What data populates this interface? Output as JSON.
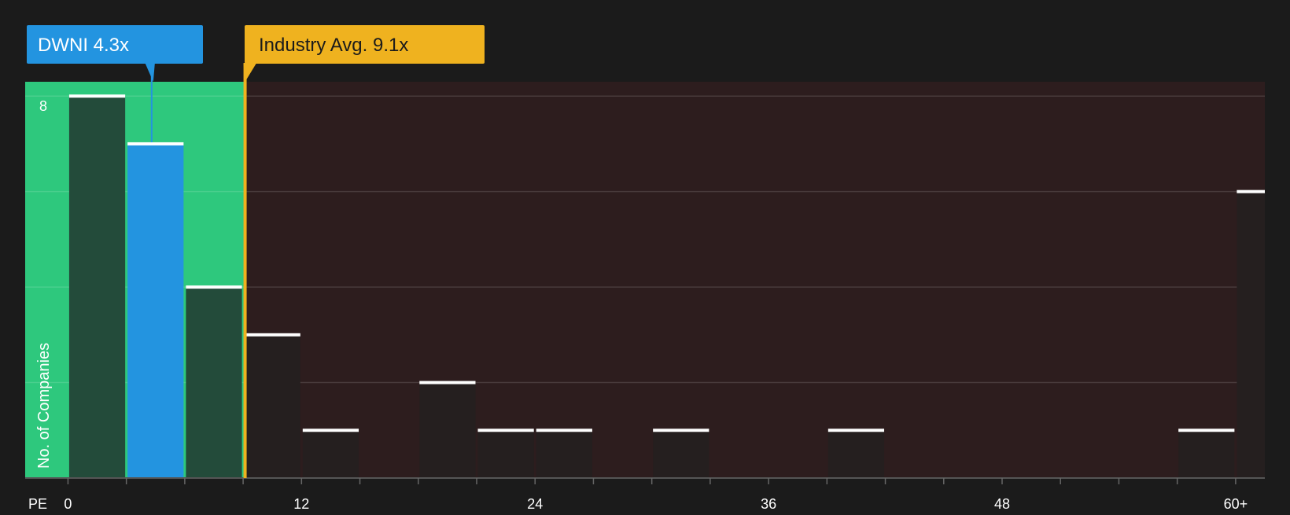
{
  "colors": {
    "background": "#1b1b1b",
    "plot_background": "#2d1d1e",
    "undervalued_zone": "#2ec87d",
    "bar_in_zone": "#234b3a",
    "bar_out_zone": "#251f1f",
    "highlight_bar": "#2394e0",
    "bar_cap": "#ffffff",
    "industry_line": "#efb21f",
    "gridline": "#4a3a3b",
    "axis_text": "#ffffff"
  },
  "callouts": {
    "company": {
      "label": "DWNI 4.3x",
      "value": 4.3
    },
    "industry": {
      "label": "Industry Avg. 9.1x",
      "value": 9.1
    }
  },
  "chart_data": {
    "type": "bar",
    "title": "",
    "xlabel": "PE",
    "ylabel": "No. of Companies",
    "x_ticks": [
      "0",
      "12",
      "24",
      "36",
      "48",
      "60+"
    ],
    "x_tick_values": [
      0,
      12,
      24,
      36,
      48,
      60
    ],
    "y_tick_labels": [
      "8"
    ],
    "ylim": [
      0,
      8.3
    ],
    "xlim": [
      -2.2,
      61.5
    ],
    "bin_width": 3,
    "undervalued_max_pe": 9.1,
    "bins": [
      {
        "start": 0,
        "end": 3,
        "count": 8
      },
      {
        "start": 3,
        "end": 6,
        "count": 7,
        "highlight": true
      },
      {
        "start": 6,
        "end": 9,
        "count": 4
      },
      {
        "start": 9,
        "end": 12,
        "count": 3
      },
      {
        "start": 12,
        "end": 15,
        "count": 1
      },
      {
        "start": 18,
        "end": 21,
        "count": 2
      },
      {
        "start": 21,
        "end": 24,
        "count": 1
      },
      {
        "start": 24,
        "end": 27,
        "count": 1
      },
      {
        "start": 30,
        "end": 33,
        "count": 1
      },
      {
        "start": 39,
        "end": 42,
        "count": 1
      },
      {
        "start": 57,
        "end": 60,
        "count": 1
      },
      {
        "start": 60,
        "end": 63,
        "count": 6
      }
    ],
    "grid": true,
    "legend": "none"
  }
}
